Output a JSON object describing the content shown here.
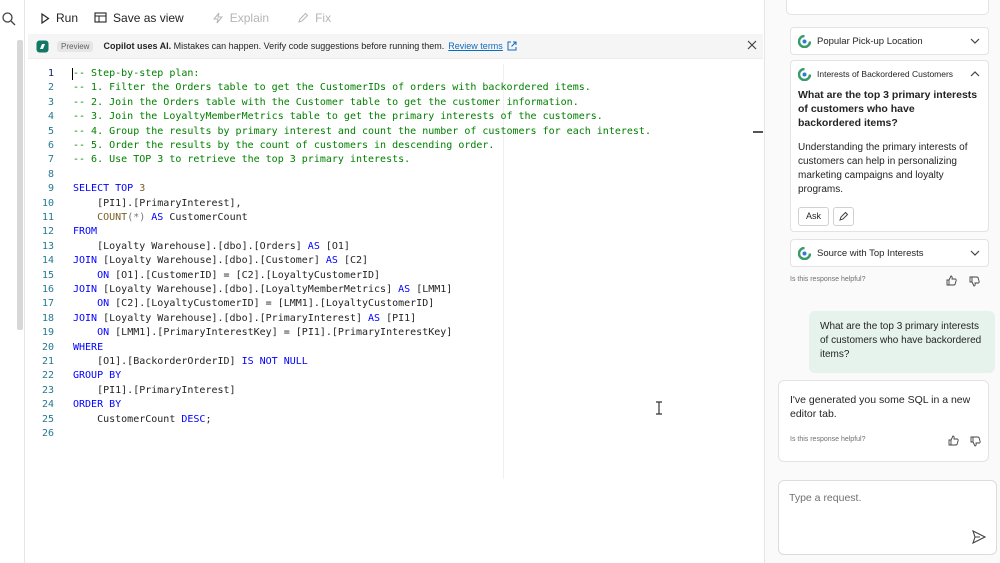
{
  "toolbar": {
    "run": "Run",
    "save_as_view": "Save as view",
    "explain": "Explain",
    "fix": "Fix"
  },
  "banner": {
    "badge": "Preview",
    "bold": "Copilot uses AI.",
    "message": " Mistakes can happen. Verify code suggestions before running them.",
    "link": "Review terms"
  },
  "editor": {
    "lines": [
      {
        "n": "1",
        "parts": [
          [
            "cmt",
            "-- Step-by-step plan:"
          ]
        ]
      },
      {
        "n": "2",
        "parts": [
          [
            "cmt",
            "-- 1. Filter the Orders table to get the CustomerIDs of orders with backordered items."
          ]
        ]
      },
      {
        "n": "3",
        "parts": [
          [
            "cmt",
            "-- 2. Join the Orders table with the Customer table to get the customer information."
          ]
        ]
      },
      {
        "n": "4",
        "parts": [
          [
            "cmt",
            "-- 3. Join the LoyaltyMemberMetrics table to get the primary interests of the customers."
          ]
        ]
      },
      {
        "n": "5",
        "parts": [
          [
            "cmt",
            "-- 4. Group the results by primary interest and count the number of customers for each interest."
          ]
        ]
      },
      {
        "n": "6",
        "parts": [
          [
            "cmt",
            "-- 5. Order the results by the count of customers in descending order."
          ]
        ]
      },
      {
        "n": "7",
        "parts": [
          [
            "cmt",
            "-- 6. Use TOP 3 to retrieve the top 3 primary interests."
          ]
        ]
      },
      {
        "n": "8",
        "parts": []
      },
      {
        "n": "9",
        "parts": [
          [
            "kw",
            "SELECT TOP "
          ],
          [
            "fn",
            "3"
          ]
        ]
      },
      {
        "n": "10",
        "parts": [
          [
            "idn",
            "    [PI1].[PrimaryInterest],"
          ]
        ]
      },
      {
        "n": "11",
        "parts": [
          [
            "idn",
            "    "
          ],
          [
            "fn",
            "COUNT"
          ],
          [
            "op",
            "(*)"
          ],
          [
            "kw",
            " AS "
          ],
          [
            "idn",
            "CustomerCount"
          ]
        ]
      },
      {
        "n": "12",
        "parts": [
          [
            "kw",
            "FROM"
          ]
        ]
      },
      {
        "n": "13",
        "parts": [
          [
            "idn",
            "    [Loyalty Warehouse].[dbo].[Orders]"
          ],
          [
            "kw",
            " AS "
          ],
          [
            "idn",
            "[O1]"
          ]
        ]
      },
      {
        "n": "14",
        "parts": [
          [
            "kw",
            "JOIN "
          ],
          [
            "idn",
            "[Loyalty Warehouse].[dbo].[Customer]"
          ],
          [
            "kw",
            " AS "
          ],
          [
            "idn",
            "[C2]"
          ]
        ]
      },
      {
        "n": "15",
        "parts": [
          [
            "kw",
            "    ON "
          ],
          [
            "idn",
            "[O1].[CustomerID] = [C2].[LoyaltyCustomerID]"
          ]
        ]
      },
      {
        "n": "16",
        "parts": [
          [
            "kw",
            "JOIN "
          ],
          [
            "idn",
            "[Loyalty Warehouse].[dbo].[LoyaltyMemberMetrics]"
          ],
          [
            "kw",
            " AS "
          ],
          [
            "idn",
            "[LMM1]"
          ]
        ]
      },
      {
        "n": "17",
        "parts": [
          [
            "kw",
            "    ON "
          ],
          [
            "idn",
            "[C2].[LoyaltyCustomerID] = [LMM1].[LoyaltyCustomerID]"
          ]
        ]
      },
      {
        "n": "18",
        "parts": [
          [
            "kw",
            "JOIN "
          ],
          [
            "idn",
            "[Loyalty Warehouse].[dbo].[PrimaryInterest]"
          ],
          [
            "kw",
            " AS "
          ],
          [
            "idn",
            "[PI1]"
          ]
        ]
      },
      {
        "n": "19",
        "parts": [
          [
            "kw",
            "    ON "
          ],
          [
            "idn",
            "[LMM1].[PrimaryInterestKey] = [PI1].[PrimaryInterestKey]"
          ]
        ]
      },
      {
        "n": "20",
        "parts": [
          [
            "kw",
            "WHERE"
          ]
        ]
      },
      {
        "n": "21",
        "parts": [
          [
            "idn",
            "    [O1].[BackorderOrderID]"
          ],
          [
            "kw",
            " IS NOT NULL"
          ]
        ]
      },
      {
        "n": "22",
        "parts": [
          [
            "kw",
            "GROUP BY"
          ]
        ]
      },
      {
        "n": "23",
        "parts": [
          [
            "idn",
            "    [PI1].[PrimaryInterest]"
          ]
        ]
      },
      {
        "n": "24",
        "parts": [
          [
            "kw",
            "ORDER BY"
          ]
        ]
      },
      {
        "n": "25",
        "parts": [
          [
            "idn",
            "    CustomerCount "
          ],
          [
            "kw",
            "DESC"
          ],
          [
            "idn",
            ";"
          ]
        ]
      },
      {
        "n": "26",
        "parts": []
      }
    ]
  },
  "pane": {
    "acc_popular": "Popular Pick-up Location",
    "acc_interests": "Interests of Backordered Customers",
    "question": "What are the top 3 primary interests of customers who have backordered items?",
    "description": "Understanding the primary interests of customers can help in personalizing marketing campaigns and loyalty programs.",
    "ask": "Ask",
    "acc_source": "Source with Top Interests",
    "helpful": "Is this response helpful?",
    "user_message": "What are the top 3 primary interests of customers who have backordered items?",
    "ai_message": "I've generated you some SQL in a new editor tab.",
    "input_placeholder": "Type a request."
  },
  "colors": {
    "accent_link": "#0f6cbd",
    "comment": "#008000",
    "keyword": "#0000ff",
    "user_bubble": "#e6f2ec"
  }
}
